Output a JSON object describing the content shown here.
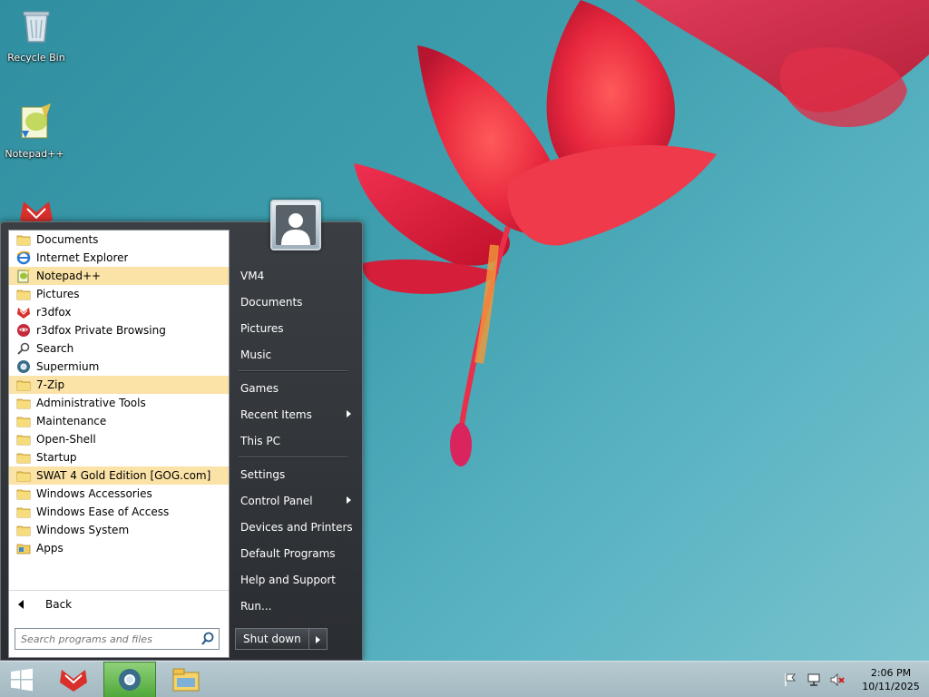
{
  "desktop": {
    "icons": [
      {
        "label": "Recycle Bin",
        "icon": "recycle-bin-icon"
      },
      {
        "label": "Notepad++",
        "icon": "notepadpp-icon"
      },
      {
        "label": "",
        "icon": "r3dfox-icon"
      }
    ]
  },
  "start_menu": {
    "programs": [
      {
        "label": "Documents",
        "icon": "folder-icon",
        "highlighted": false
      },
      {
        "label": "Internet Explorer",
        "icon": "internet-explorer-icon",
        "highlighted": false
      },
      {
        "label": "Notepad++",
        "icon": "notepadpp-icon",
        "highlighted": true
      },
      {
        "label": "Pictures",
        "icon": "folder-icon",
        "highlighted": false
      },
      {
        "label": "r3dfox",
        "icon": "r3dfox-icon",
        "highlighted": false
      },
      {
        "label": "r3dfox Private Browsing",
        "icon": "r3dfox-private-icon",
        "highlighted": false
      },
      {
        "label": "Search",
        "icon": "search-icon",
        "highlighted": false
      },
      {
        "label": "Supermium",
        "icon": "supermium-icon",
        "highlighted": false
      },
      {
        "label": "7-Zip",
        "icon": "folder-icon",
        "highlighted": true
      },
      {
        "label": "Administrative Tools",
        "icon": "folder-icon",
        "highlighted": false
      },
      {
        "label": "Maintenance",
        "icon": "folder-icon",
        "highlighted": false
      },
      {
        "label": "Open-Shell",
        "icon": "folder-icon",
        "highlighted": false
      },
      {
        "label": "Startup",
        "icon": "folder-icon",
        "highlighted": false
      },
      {
        "label": "SWAT 4 Gold Edition [GOG.com]",
        "icon": "folder-icon",
        "highlighted": true
      },
      {
        "label": "Windows Accessories",
        "icon": "folder-icon",
        "highlighted": false
      },
      {
        "label": "Windows Ease of Access",
        "icon": "folder-icon",
        "highlighted": false
      },
      {
        "label": "Windows System",
        "icon": "folder-icon",
        "highlighted": false
      },
      {
        "label": "Apps",
        "icon": "apps-folder-icon",
        "highlighted": false
      }
    ],
    "back_label": "Back",
    "search_placeholder": "Search programs and files",
    "right": {
      "user": "VM4",
      "group1": [
        "Documents",
        "Pictures",
        "Music"
      ],
      "games": "Games",
      "recent_items": "Recent Items",
      "this_pc": "This PC",
      "settings": "Settings",
      "control_panel": "Control Panel",
      "devices_printers": "Devices and Printers",
      "default_programs": "Default Programs",
      "help_support": "Help and Support",
      "run": "Run..."
    },
    "shutdown_label": "Shut down"
  },
  "taskbar": {
    "time": "2:06 PM",
    "date": "10/11/2025"
  },
  "colors": {
    "highlight": "#fbe3a8",
    "taskbar": "#a3b8c0",
    "menu_dark": "#2a2d31"
  }
}
